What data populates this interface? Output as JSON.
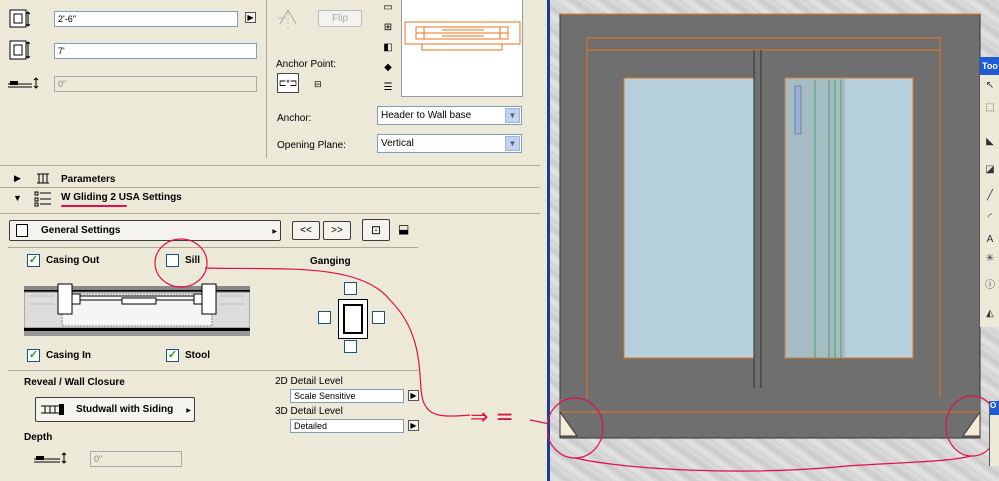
{
  "top_fields": {
    "width": "2'-6\"",
    "height": "7'",
    "offset": "0\""
  },
  "flip_label": "Flip",
  "anchor_point_label": "Anchor Point:",
  "anchor_label": "Anchor:",
  "anchor_value": "Header to Wall base",
  "opening_plane_label": "Opening Plane:",
  "opening_plane_value": "Vertical",
  "sections": {
    "parameters": "Parameters",
    "settings": "W Gliding 2 USA Settings"
  },
  "general_settings": "General Settings",
  "nav_prev": "<<",
  "nav_next": ">>",
  "checks": {
    "casing_out": {
      "label": "Casing Out",
      "checked": true
    },
    "sill": {
      "label": "Sill",
      "checked": false
    },
    "casing_in": {
      "label": "Casing In",
      "checked": true
    },
    "stool": {
      "label": "Stool",
      "checked": true
    }
  },
  "ganging_label": "Ganging",
  "reveal_label": "Reveal / Wall Closure",
  "studwall_label": "Studwall with Siding",
  "depth_label": "Depth",
  "depth_value": "0\"",
  "detail_2d_label": "2D Detail Level",
  "detail_2d_value": "Scale Sensitive",
  "detail_3d_label": "3D Detail Level",
  "detail_3d_value": "Detailed",
  "annotation_arrow": "⇒ =",
  "toolbox": {
    "title": "Too",
    "bottom_title": "O"
  },
  "colors": {
    "wall_gray": "#6f6f6f",
    "outline_orange": "#e8761e",
    "glass": "#b6cfdc",
    "annotation_red": "#e0104a",
    "check_green": "#21a121"
  }
}
